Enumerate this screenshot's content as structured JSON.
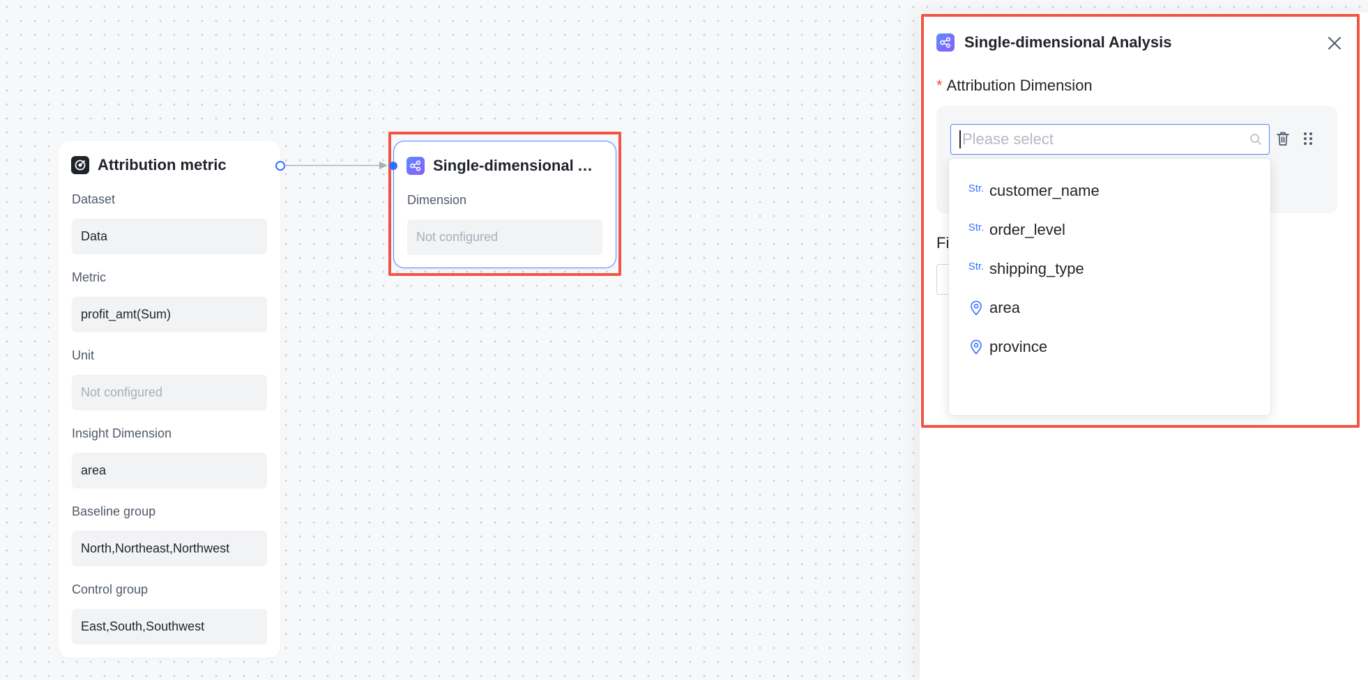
{
  "metric_node": {
    "title": "Attribution metric",
    "icon": "target-icon",
    "fields": [
      {
        "label": "Dataset",
        "value": "Data",
        "placeholder": false
      },
      {
        "label": "Metric",
        "value": "profit_amt(Sum)",
        "placeholder": false
      },
      {
        "label": "Unit",
        "value": "Not configured",
        "placeholder": true
      },
      {
        "label": "Insight Dimension",
        "value": "area",
        "placeholder": false
      },
      {
        "label": "Baseline group",
        "value": "North,Northeast,Northwest",
        "placeholder": false
      },
      {
        "label": "Control group",
        "value": "East,South,Southwest",
        "placeholder": false
      }
    ]
  },
  "sda_node": {
    "title": "Single-dimensional A...",
    "icon": "share-nodes-icon",
    "dimension_label": "Dimension",
    "dimension_value": "Not configured"
  },
  "panel": {
    "title": "Single-dimensional Analysis",
    "required_mark": "*",
    "attribution_label": "Attribution Dimension",
    "search_placeholder": "Please select",
    "partial_label": "Fi",
    "options": [
      {
        "type": "Str.",
        "icon": "string-type-icon",
        "label": "customer_name"
      },
      {
        "type": "Str.",
        "icon": "string-type-icon",
        "label": "order_level"
      },
      {
        "type": "Str.",
        "icon": "string-type-icon",
        "label": "shipping_type"
      },
      {
        "type": "geo",
        "icon": "location-pin-icon",
        "label": "area"
      },
      {
        "type": "geo",
        "icon": "location-pin-icon",
        "label": "province"
      }
    ]
  },
  "colors": {
    "accent": "#3370ff",
    "highlight": "#f05545",
    "required": "#f54a45"
  }
}
